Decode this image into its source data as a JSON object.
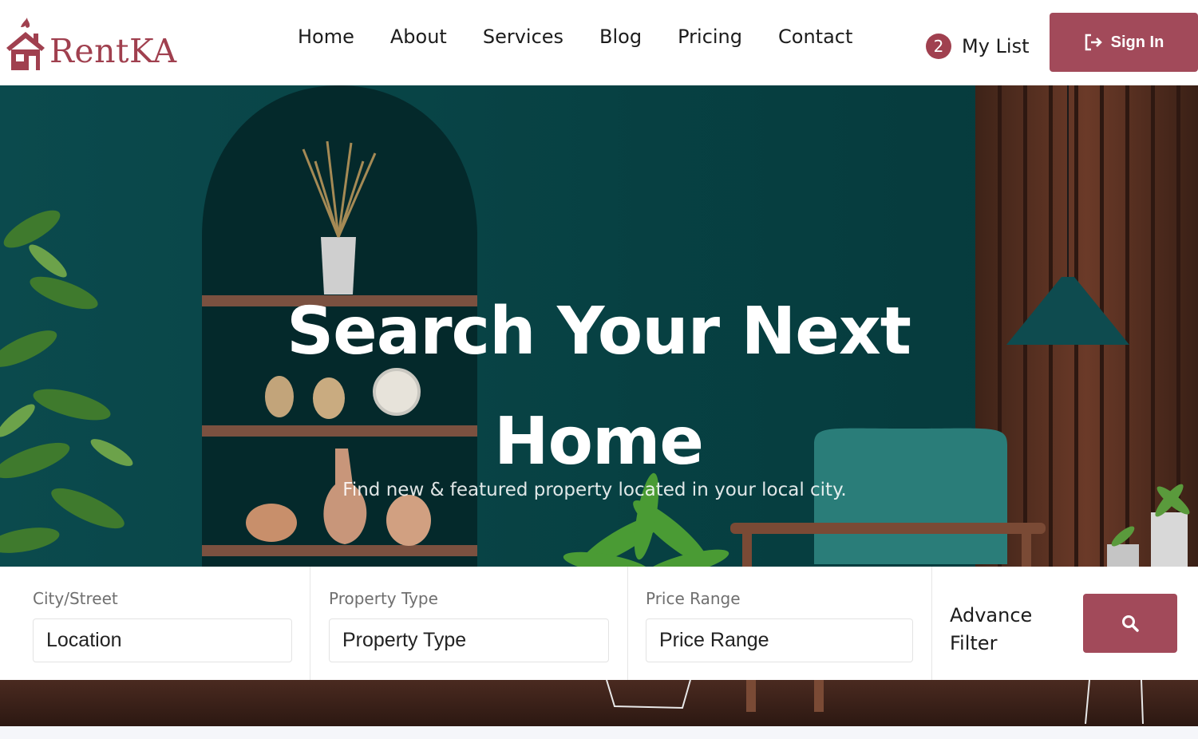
{
  "brand": {
    "name": "RentKA"
  },
  "nav": {
    "items": [
      {
        "label": "Home"
      },
      {
        "label": "About"
      },
      {
        "label": "Services"
      },
      {
        "label": "Blog"
      },
      {
        "label": "Pricing"
      },
      {
        "label": "Contact"
      }
    ]
  },
  "my_list": {
    "count": "2",
    "label": "My List"
  },
  "sign_in": {
    "label": "Sign In",
    "icon": "sign-in-icon"
  },
  "hero": {
    "title": "Search Your Next Home",
    "subtitle": "Find new & featured property located in your local city."
  },
  "search": {
    "city": {
      "label": "City/Street",
      "value": "Location"
    },
    "property_type": {
      "label": "Property Type",
      "value": "Property Type"
    },
    "price_range": {
      "label": "Price Range",
      "value": "Price Range"
    },
    "advance_filter": {
      "label": "Advance Filter"
    },
    "button_icon": "search-icon"
  },
  "colors": {
    "accent": "#a24a5a",
    "hero_bg": "#063c3f",
    "text": "#1c1c1c"
  }
}
